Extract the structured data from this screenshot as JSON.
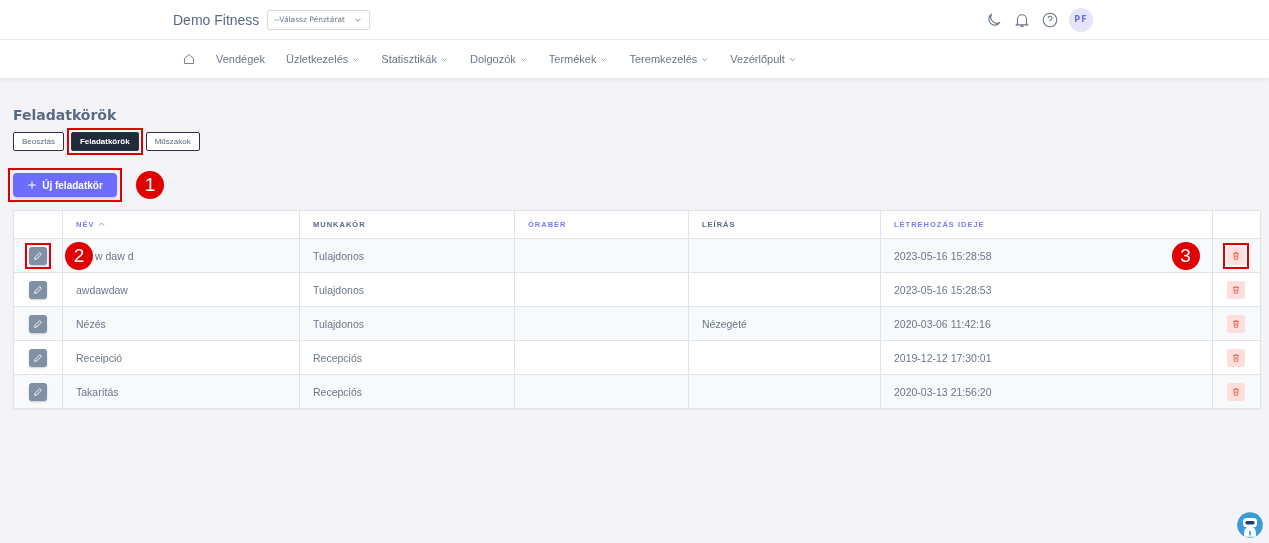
{
  "header": {
    "brand": "Demo Fitness",
    "register_select": {
      "value": "--Válassz Pénztárat"
    },
    "avatar": "PF"
  },
  "nav": [
    {
      "label": "Vendégek",
      "dropdown": false
    },
    {
      "label": "Üzletkezelés",
      "dropdown": true
    },
    {
      "label": "Statisztikák",
      "dropdown": true
    },
    {
      "label": "Dolgozók",
      "dropdown": true
    },
    {
      "label": "Termékek",
      "dropdown": true
    },
    {
      "label": "Teremkezelés",
      "dropdown": true
    },
    {
      "label": "Vezérlőpult",
      "dropdown": true
    }
  ],
  "page_title": "Feladatkörök",
  "tabs": [
    {
      "label": "Beosztás",
      "selected": false
    },
    {
      "label": "Feladatkörök",
      "selected": true
    },
    {
      "label": "Műszakok",
      "selected": false
    }
  ],
  "new_button": "Új feladatkör",
  "table": {
    "columns": [
      {
        "label": "NÉV",
        "sortable": true,
        "sorted": true
      },
      {
        "label": "MUNKAKÖR",
        "sortable": false,
        "sorted": false
      },
      {
        "label": "ÓRABÉR",
        "sortable": true,
        "sorted": false
      },
      {
        "label": "LEÍRÁS",
        "sortable": false,
        "sorted": false
      },
      {
        "label": "LÉTREHOZÁS IDEJE",
        "sortable": true,
        "sorted": false
      }
    ],
    "rows": [
      {
        "name": "w daw d",
        "partly_hidden": true,
        "job": "Tulajdonos",
        "created": "2023-05-16 15:28:58"
      },
      {
        "name": "awdawdaw",
        "job": "Tulajdonos",
        "created": "2023-05-16 15:28:53"
      },
      {
        "name": "Nézés",
        "job": "Tulajdonos",
        "description": "Nézegeté",
        "created": "2020-03-06 11:42:16"
      },
      {
        "name": "Receipció",
        "job": "Recepciós",
        "created": "2019-12-12 17:30:01"
      },
      {
        "name": "Takarítás",
        "job": "Recepciós",
        "created": "2020-03-13 21:56:20"
      }
    ]
  },
  "annotations": [
    {
      "kind": "badge",
      "label": "1"
    },
    {
      "kind": "badge",
      "label": "2"
    },
    {
      "kind": "badge",
      "label": "3"
    }
  ]
}
